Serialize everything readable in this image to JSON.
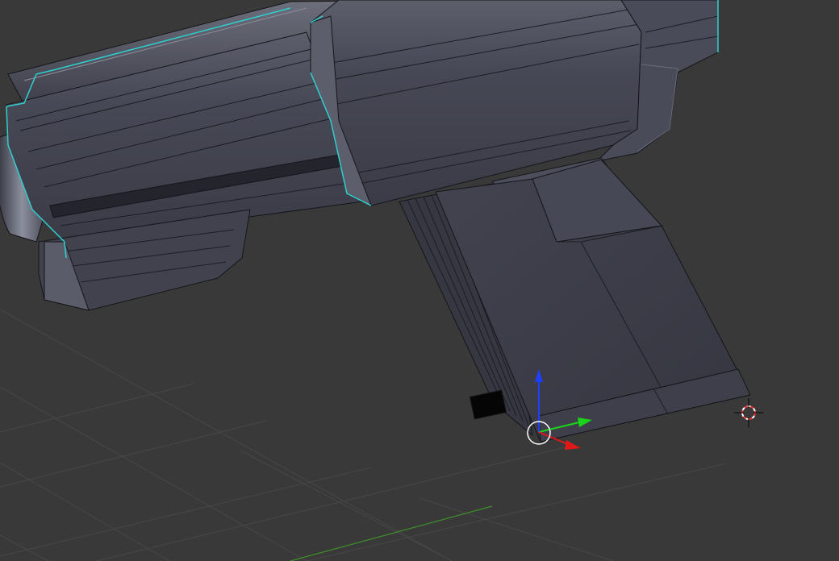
{
  "viewport": {
    "background_color": "#393939",
    "grid_color": "#474747",
    "y_axis_line_color": "#3f8f2a"
  },
  "model": {
    "face_color": "#3b3c47",
    "face_light_color": "#5a5c6a",
    "face_highlight_color": "#8a8d9c",
    "edge_color": "#14151a",
    "selection_outline_color": "#2fd0d0"
  },
  "gizmo": {
    "z_axis_color": "#1f3fff",
    "y_axis_color": "#19d419",
    "x_axis_color": "#e01818",
    "origin_ring_color": "#ffffff"
  },
  "cursor_3d": {
    "ring_color_a": "#ff3030",
    "ring_color_b": "#ffffff",
    "icon": "3d-cursor-icon"
  }
}
